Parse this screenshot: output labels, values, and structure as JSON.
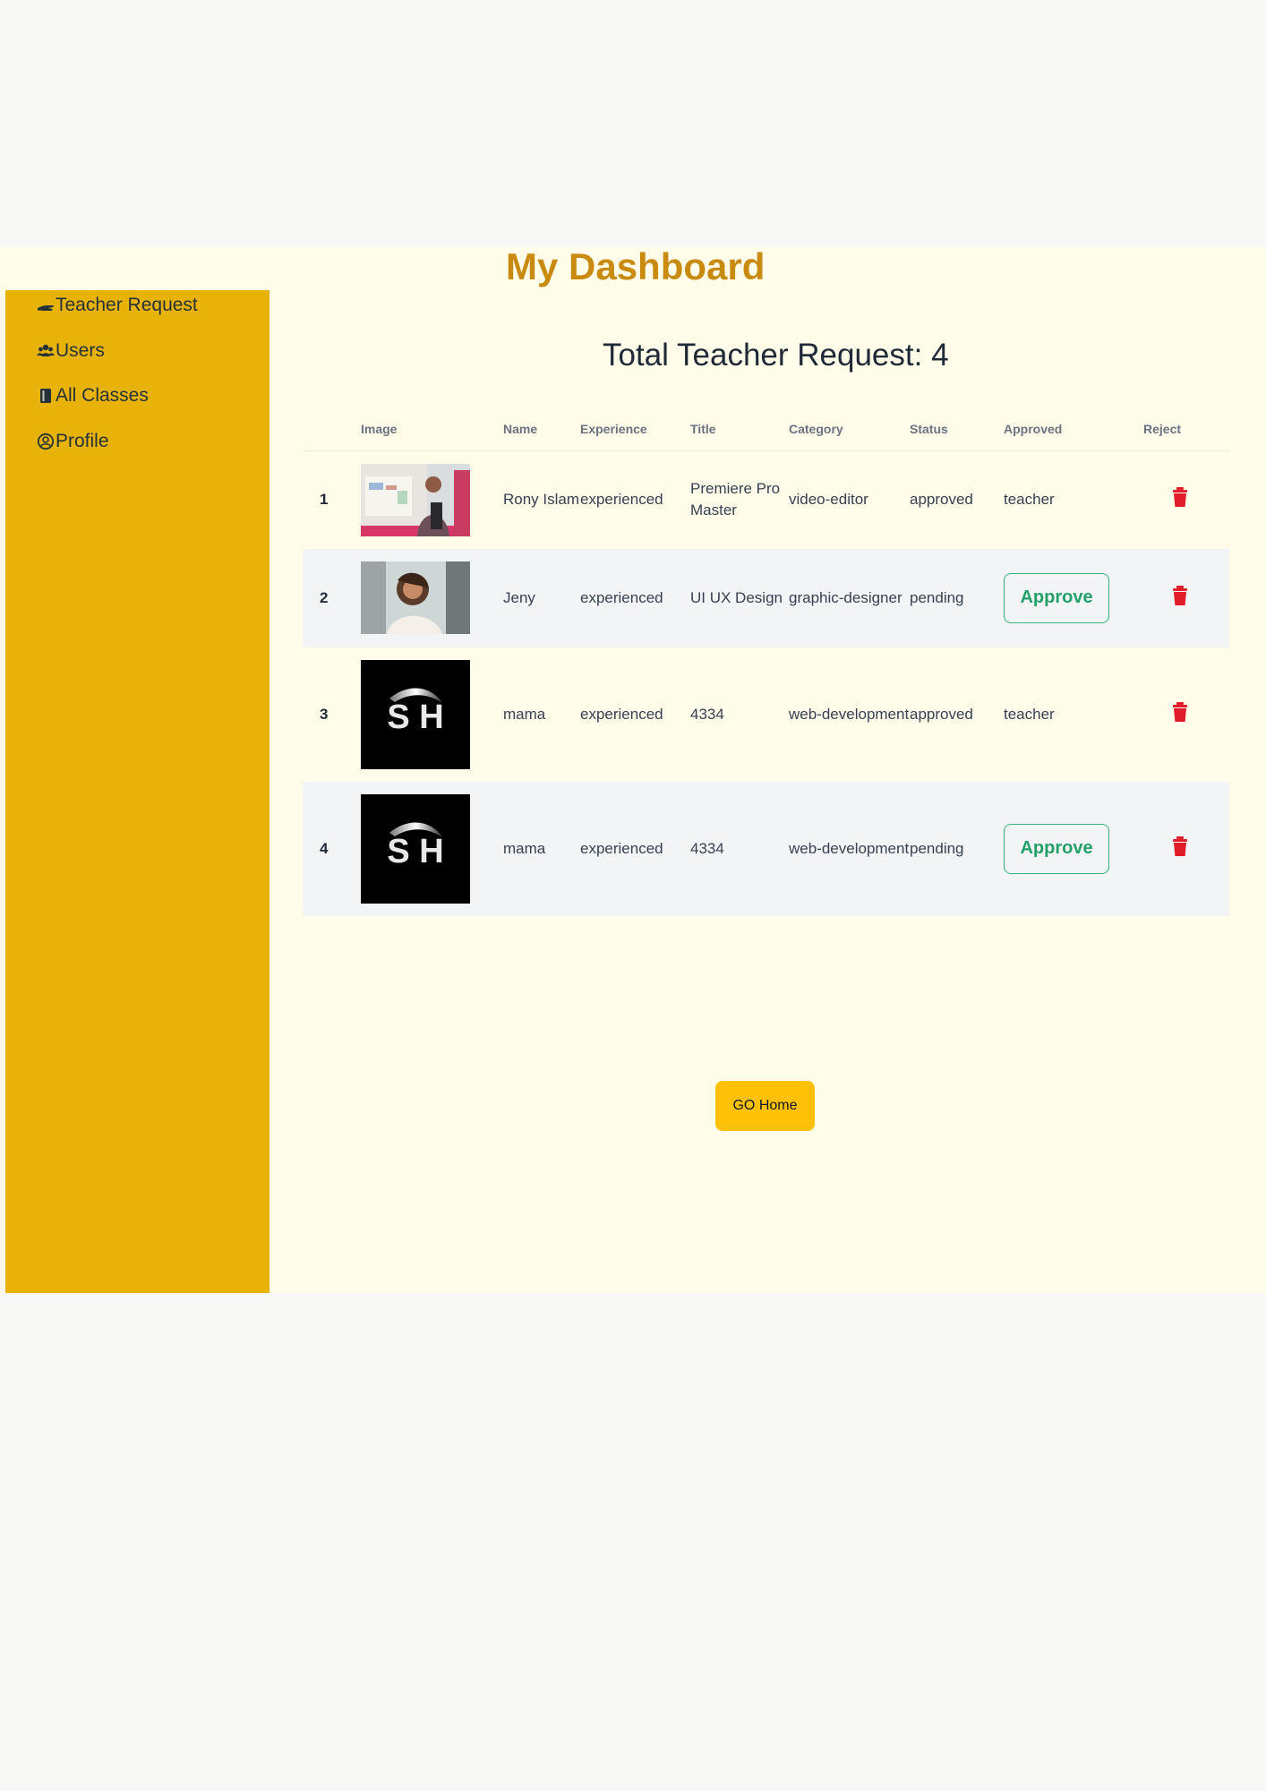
{
  "dashboard": {
    "title": "My Dashboard"
  },
  "sidebar": {
    "items": [
      {
        "label": "Teacher Request",
        "icon": "hand-icon"
      },
      {
        "label": "Users",
        "icon": "users-icon"
      },
      {
        "label": "All Classes",
        "icon": "book-icon"
      },
      {
        "label": "Profile",
        "icon": "user-circle-icon"
      }
    ]
  },
  "main": {
    "total_requests_label": "Total Teacher Request: 4",
    "table": {
      "headers": [
        "",
        "Image",
        "Name",
        "Experience",
        "Title",
        "Category",
        "Status",
        "Approved",
        "Reject"
      ],
      "rows": [
        {
          "number": "1",
          "image": "teacher-photo",
          "name": "Rony Islam",
          "experience": "experienced",
          "title": "Premiere Pro Master",
          "category": "video-editor",
          "status": "approved",
          "approved": "teacher",
          "reject_icon": "trash-icon"
        },
        {
          "number": "2",
          "image": "teacher-photo",
          "name": "Jeny",
          "experience": "experienced",
          "title": "UI UX Design",
          "category": "graphic-designer",
          "status": "pending",
          "approved": "Approve",
          "reject_icon": "trash-icon"
        },
        {
          "number": "3",
          "image": "sh-logo",
          "name": "mama",
          "experience": "experienced",
          "title": "4334",
          "category": "web-development",
          "status": "approved",
          "approved": "teacher",
          "reject_icon": "trash-icon"
        },
        {
          "number": "4",
          "image": "sh-logo",
          "name": "mama",
          "experience": "experienced",
          "title": "4334",
          "category": "web-development",
          "status": "pending",
          "approved": "Approve",
          "reject_icon": "trash-icon"
        }
      ]
    },
    "go_home_label": "GO Home"
  },
  "logo_text": "S H",
  "colors": {
    "page_background": "#f8f8f6",
    "content_background": "#fffcea",
    "sidebar_background": "#e8b309",
    "title_color": "#c88b10",
    "approve_green": "#24a16b",
    "reject_red": "#e11d2a",
    "button_yellow": "#ffc107"
  }
}
